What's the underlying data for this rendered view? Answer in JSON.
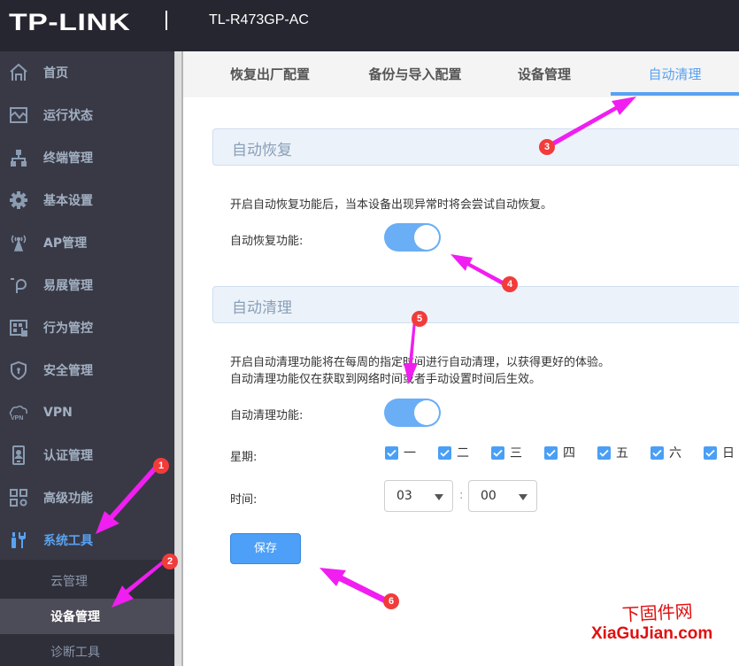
{
  "header": {
    "logo": "TP-LINK",
    "model": "TL-R473GP-AC"
  },
  "sidebar": {
    "items": [
      {
        "label": "首页",
        "icon": "home-icon"
      },
      {
        "label": "运行状态",
        "icon": "monitor-chart-icon"
      },
      {
        "label": "终端管理",
        "icon": "network-topology-icon"
      },
      {
        "label": "基本设置",
        "icon": "gear-icon"
      },
      {
        "label": "AP管理",
        "icon": "wireless-ap-icon"
      },
      {
        "label": "易展管理",
        "icon": "easy-mesh-icon"
      },
      {
        "label": "行为管控",
        "icon": "behavior-control-icon"
      },
      {
        "label": "安全管理",
        "icon": "shield-icon"
      },
      {
        "label": "VPN",
        "icon": "vpn-cloud-icon"
      },
      {
        "label": "认证管理",
        "icon": "auth-device-icon"
      },
      {
        "label": "高级功能",
        "icon": "advanced-grid-icon"
      },
      {
        "label": "系统工具",
        "icon": "tools-icon",
        "active": true
      }
    ],
    "sub_items": [
      {
        "label": "云管理"
      },
      {
        "label": "设备管理",
        "active": true
      },
      {
        "label": "诊断工具"
      }
    ]
  },
  "tabs": [
    {
      "label": "恢复出厂配置"
    },
    {
      "label": "备份与导入配置"
    },
    {
      "label": "设备管理"
    },
    {
      "label": "自动清理",
      "active": true
    }
  ],
  "auto_recover": {
    "title": "自动恢复",
    "description": "开启自动恢复功能后，当本设备出现异常时将会尝试自动恢复。",
    "toggle_label": "自动恢复功能:",
    "enabled": true
  },
  "auto_clean": {
    "title": "自动清理",
    "description_line1": "开启自动清理功能将在每周的指定时间进行自动清理，以获得更好的体验。",
    "description_line2": "自动清理功能仅在获取到网络时间或者手动设置时间后生效。",
    "toggle_label": "自动清理功能:",
    "enabled": true,
    "weekday_label": "星期:",
    "weekdays": [
      {
        "label": "一",
        "checked": true
      },
      {
        "label": "二",
        "checked": true
      },
      {
        "label": "三",
        "checked": true
      },
      {
        "label": "四",
        "checked": true
      },
      {
        "label": "五",
        "checked": true
      },
      {
        "label": "六",
        "checked": true
      },
      {
        "label": "日",
        "checked": true
      }
    ],
    "time_label": "时间:",
    "hour": "03",
    "minute": "00",
    "separator": ":"
  },
  "save_button": "保存",
  "annotations": [
    "1",
    "2",
    "3",
    "4",
    "5",
    "6"
  ],
  "annotation_color": "#f01ef0",
  "watermark": {
    "cn": "下固件网",
    "en": "XiaGuJian.com"
  },
  "colors": {
    "accent": "#5aa2f0",
    "sidebar_bg": "#393945",
    "topbar_bg": "#262630"
  }
}
